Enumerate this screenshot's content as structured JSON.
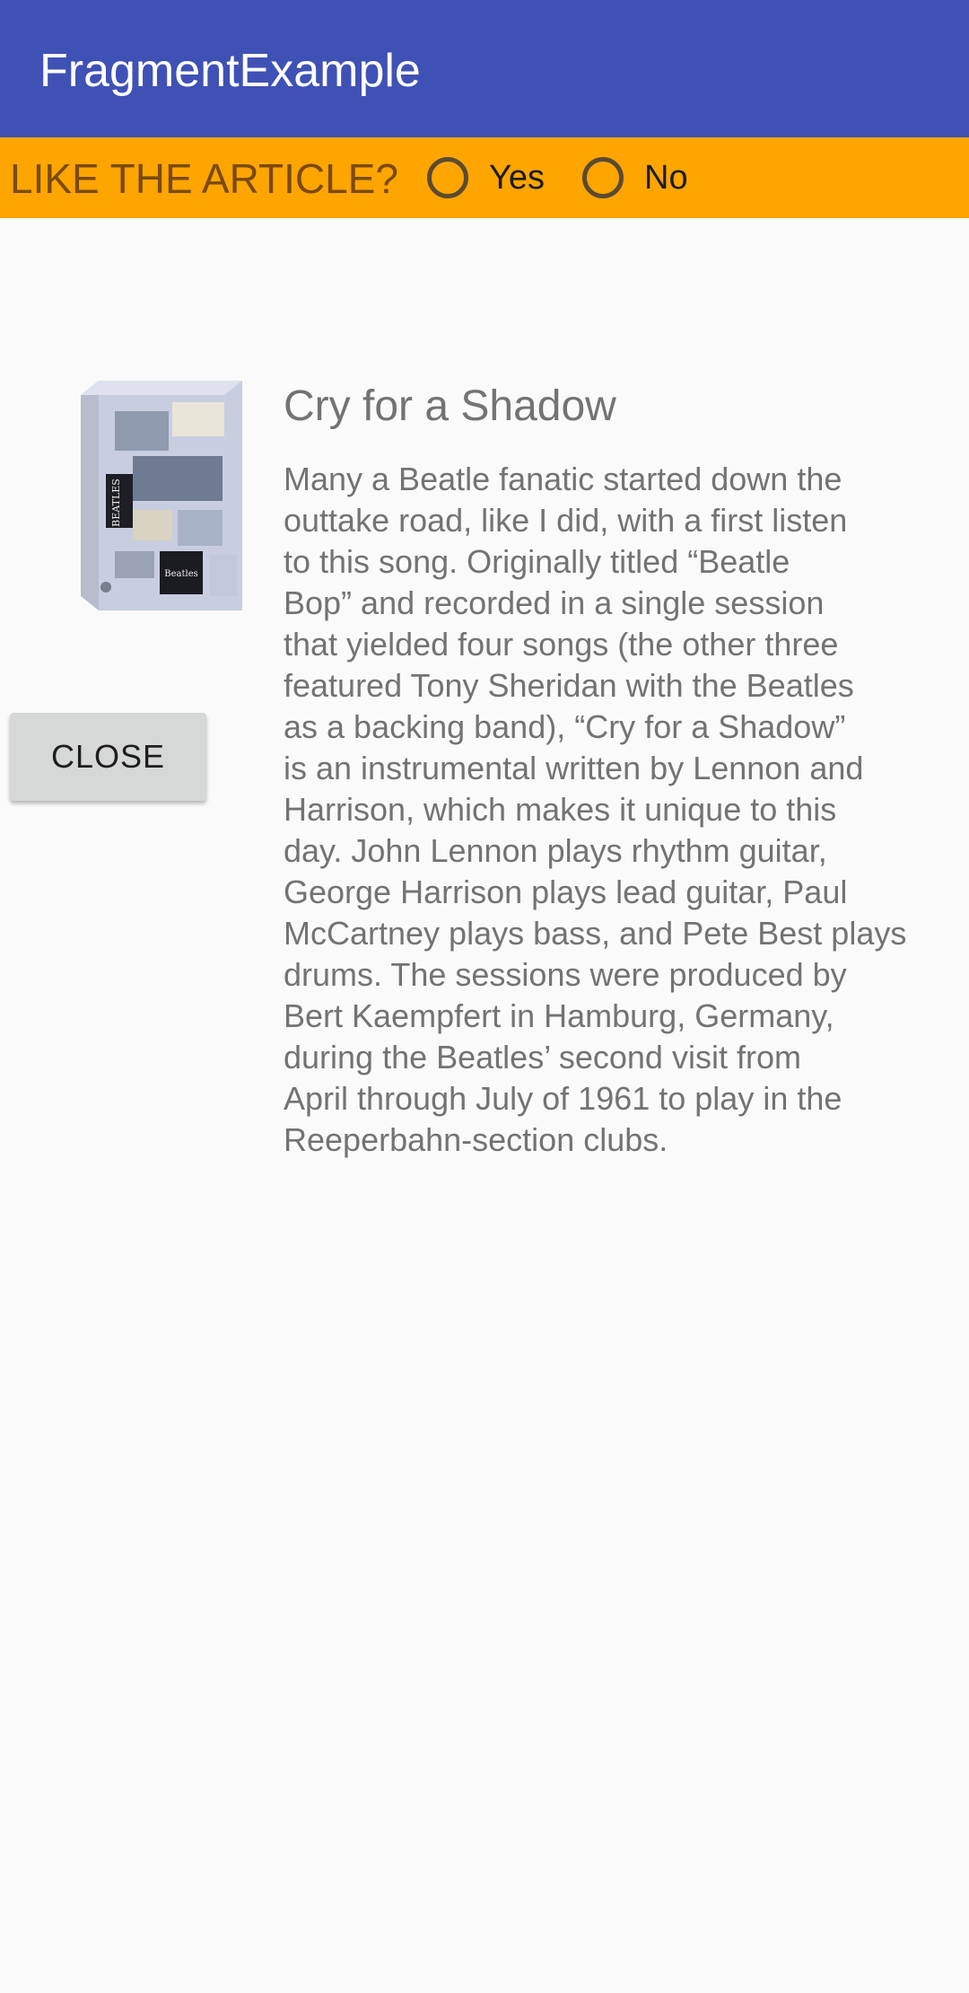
{
  "app_bar": {
    "title": "FragmentExample",
    "color": "#3f51b5"
  },
  "question": {
    "label": "LIKE THE ARTICLE?",
    "background": "#ffa500",
    "options": [
      {
        "label": "Yes",
        "selected": false
      },
      {
        "label": "No",
        "selected": false
      }
    ]
  },
  "article": {
    "image_icon": "beatles-anthology-box-image",
    "close_label": "CLOSE",
    "title": "Cry for a Shadow",
    "body_lines": [
      "Many a Beatle fanatic started down the",
      "outtake road, like I did, with a first listen",
      "to this song. Originally titled “Beatle",
      "Bop” and recorded in a single session",
      "that yielded four songs (the other three",
      "featured Tony Sheridan with the Beatles",
      "as a backing band), “Cry for a Shadow”",
      "is an instrumental written by Lennon and",
      "Harrison, which makes it unique to this",
      "day. John Lennon plays rhythm guitar,",
      "George Harrison plays lead guitar, Paul",
      "McCartney plays bass, and Pete Best plays",
      "drums. The sessions were produced by",
      "Bert Kaempfert in Hamburg, Germany,",
      "during the Beatles’ second visit from",
      "April through July of 1961 to play in the",
      "Reeperbahn-section clubs."
    ]
  }
}
